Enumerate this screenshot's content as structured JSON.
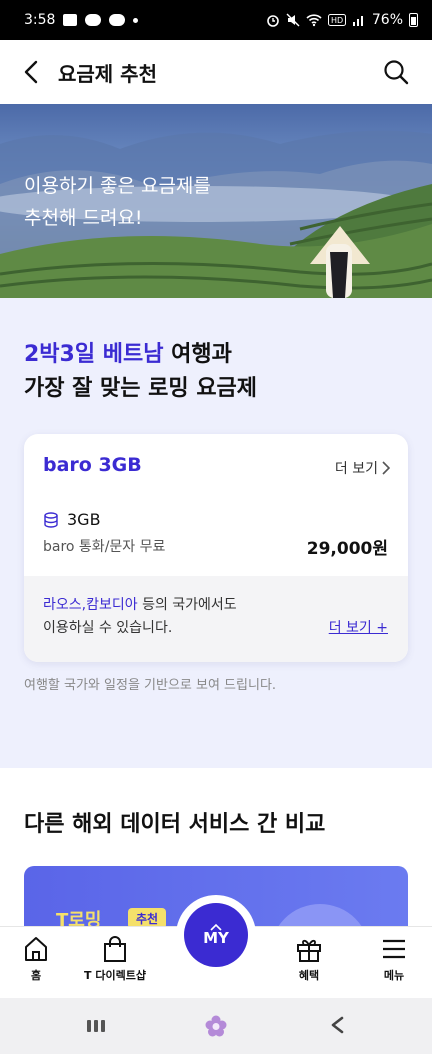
{
  "status_bar": {
    "time": "3:58",
    "battery": "76%"
  },
  "header": {
    "title": "요금제 추천"
  },
  "hero": {
    "line1": "이용하기 좋은 요금제를",
    "line2": "추천해 드려요!"
  },
  "recommendation": {
    "heading_accent": "2박3일 베트남",
    "heading_rest": " 여행과",
    "heading_line2": "가장 잘 맞는 로밍 요금제",
    "note": "여행할 국가와 일정을 기반으로 보여 드립니다."
  },
  "plan_card": {
    "name": "baro 3GB",
    "more_label": "더 보기",
    "data_amount": "3GB",
    "sub_text": "baro 통화/문자 무료",
    "price": "29,000원",
    "footer_accent": "라오스,캄보디아",
    "footer_rest": " 등의 국가에서도",
    "footer_line2": "이용하실 수 있습니다.",
    "footer_more": "더 보기 +"
  },
  "compare": {
    "title": "다른 해외 데이터 서비스 간 비교",
    "card_brand": "T로밍",
    "card_badge": "추천"
  },
  "bottom_nav": {
    "home": "홈",
    "direct_shop": "T 다이렉트샵",
    "my": "MY",
    "benefits": "혜택",
    "menu": "메뉴"
  },
  "colors": {
    "accent": "#3b2bd2",
    "section_bg": "#eef0fd"
  }
}
